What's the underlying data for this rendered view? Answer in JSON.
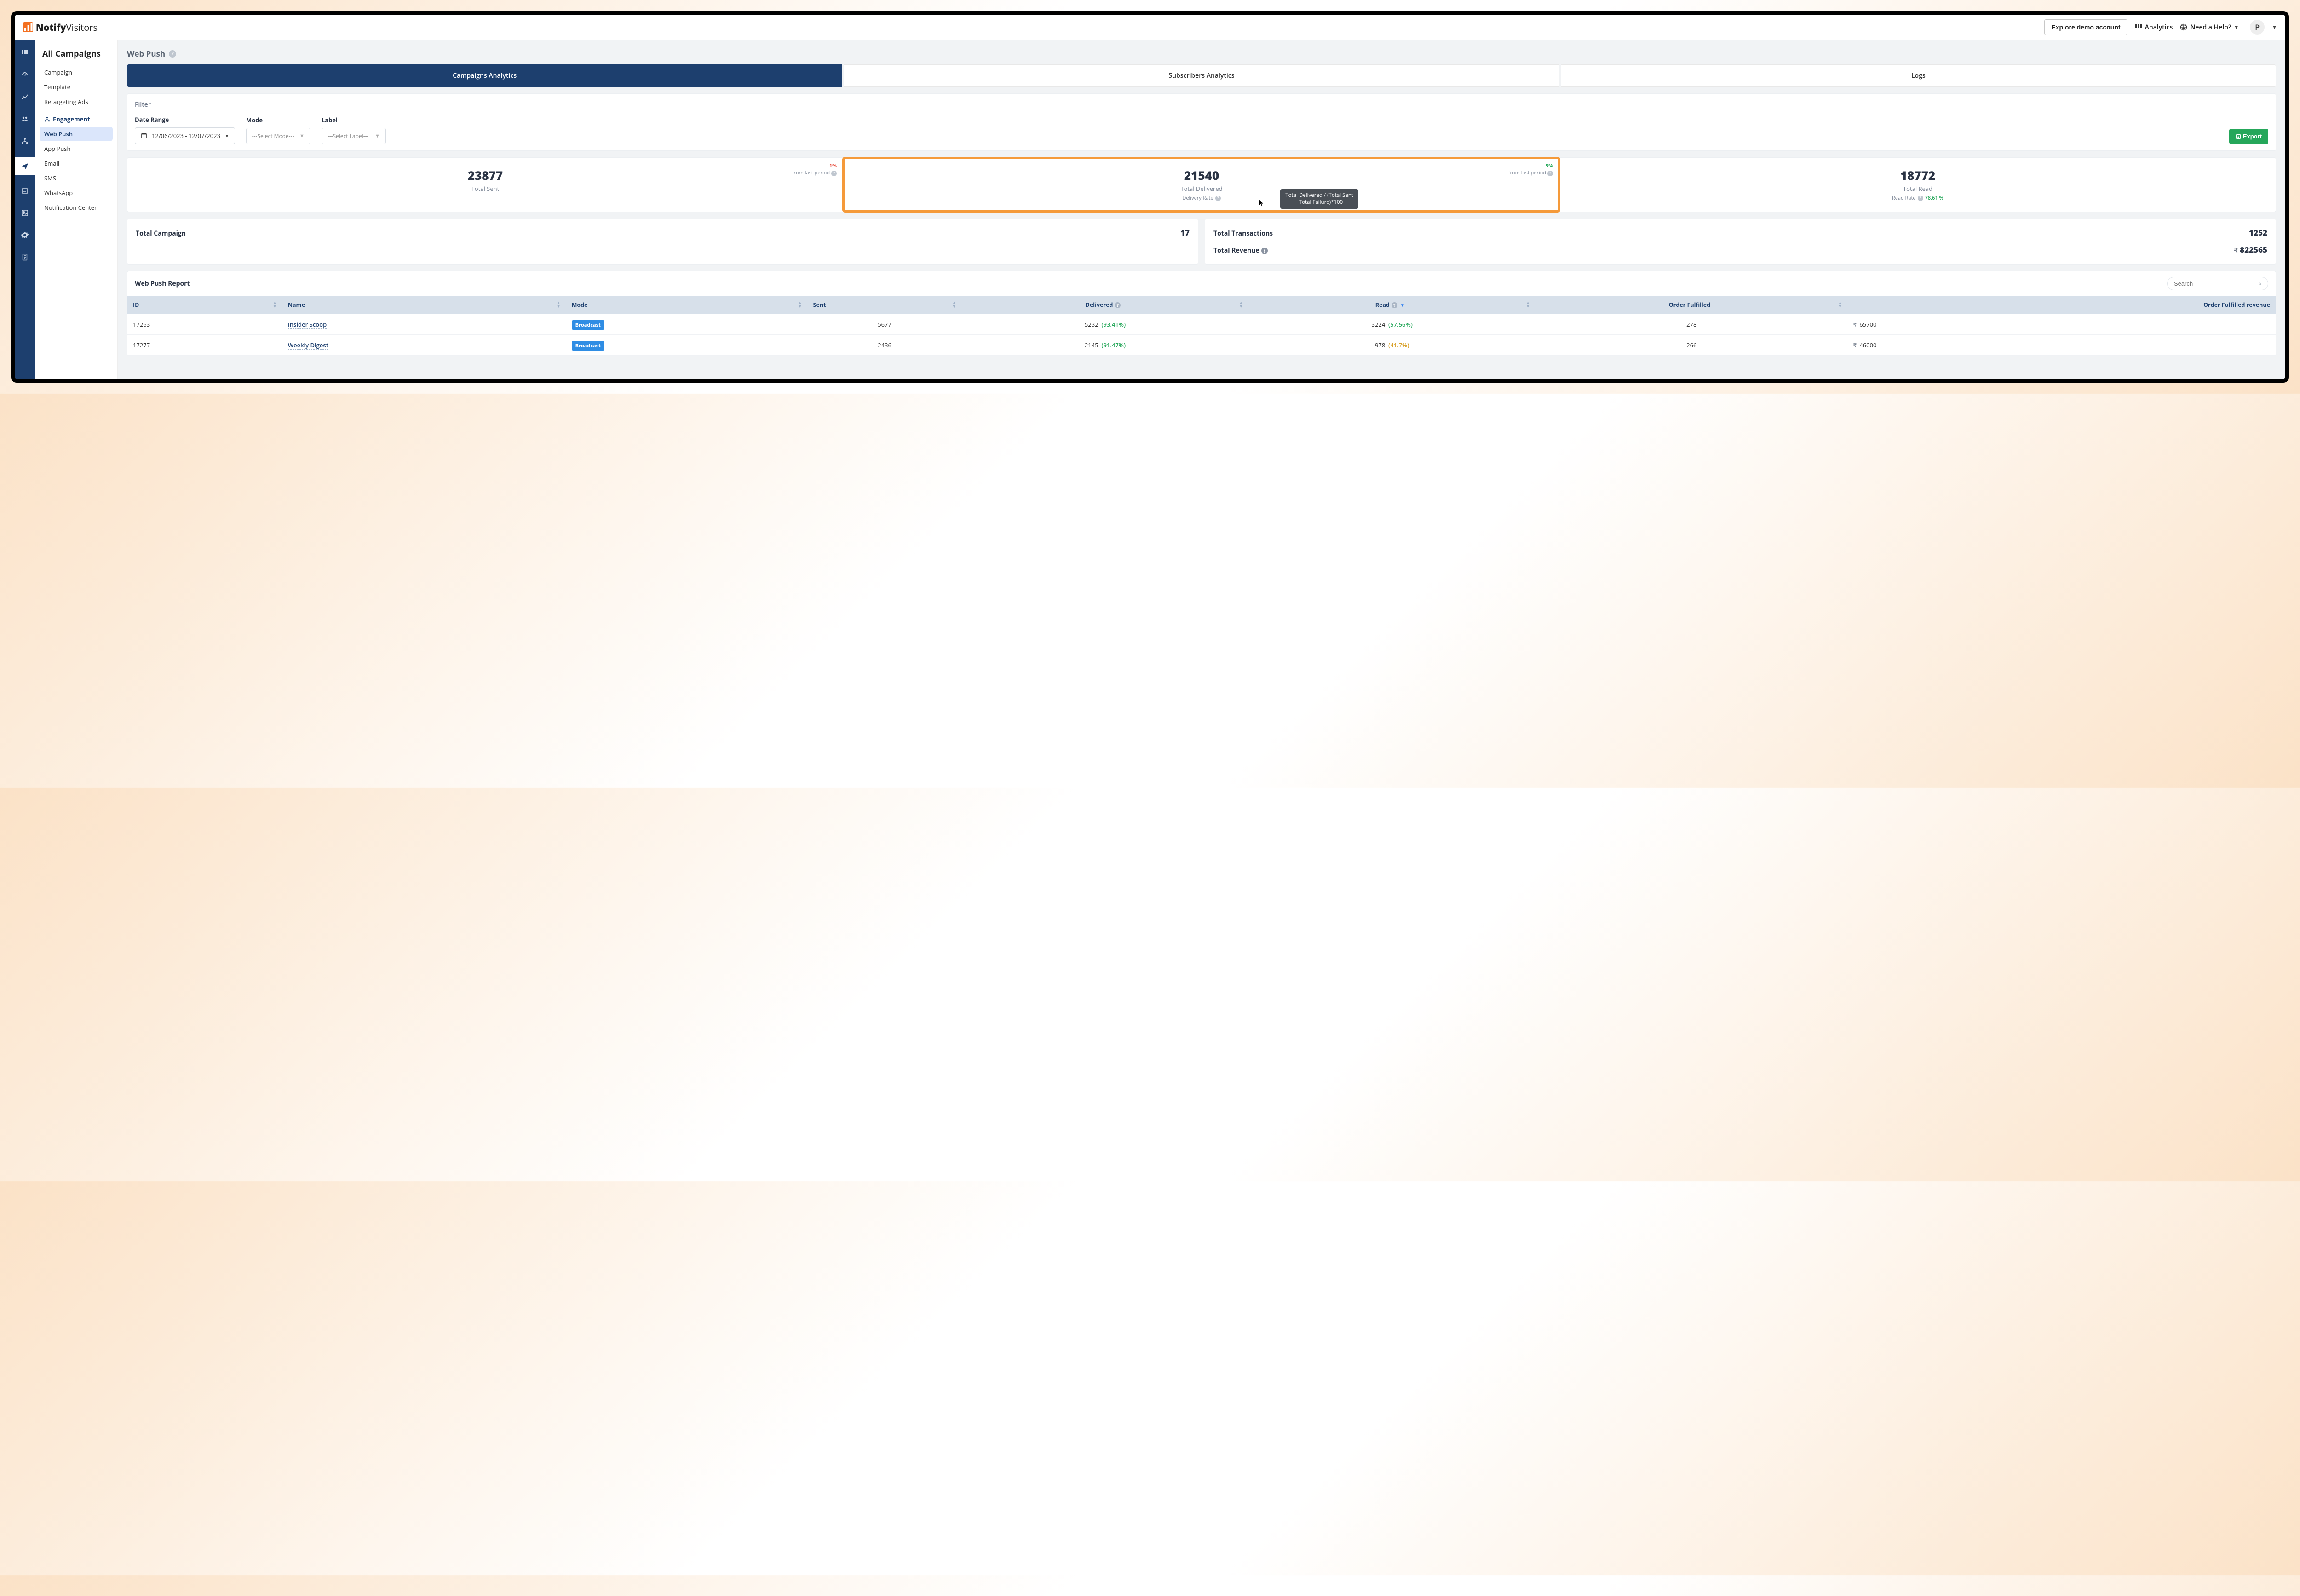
{
  "brand": {
    "prefix": "Notify",
    "suffix": "Visitors"
  },
  "topbar": {
    "demo": "Explore demo account",
    "analytics": "Analytics",
    "help": "Need a Help?",
    "avatar": "P"
  },
  "sidebar": {
    "title": "All Campaigns",
    "items": [
      {
        "label": "Campaign"
      },
      {
        "label": "Template"
      },
      {
        "label": "Retargeting Ads"
      }
    ],
    "group": "Engagement",
    "engagement_items": [
      {
        "label": "Web Push",
        "selected": true
      },
      {
        "label": "App Push"
      },
      {
        "label": "Email"
      },
      {
        "label": "SMS"
      },
      {
        "label": "WhatsApp"
      },
      {
        "label": "Notification Center"
      }
    ]
  },
  "page": {
    "title": "Web Push"
  },
  "tabs": [
    {
      "label": "Campaigns Analytics",
      "active": true
    },
    {
      "label": "Subscribers Analytics"
    },
    {
      "label": "Logs"
    }
  ],
  "filter": {
    "title": "Filter",
    "date_label": "Date Range",
    "date_value": "12/06/2023 - 12/07/2023",
    "mode_label": "Mode",
    "mode_placeholder": "---Select Mode---",
    "label_label": "Label",
    "label_placeholder": "---Select Label---",
    "export": "Export"
  },
  "stats": {
    "sent": {
      "value": "23877",
      "label": "Total Sent",
      "trend_pct": "1%",
      "trend_note": "from last period",
      "trend_color": "red"
    },
    "delivered": {
      "value": "21540",
      "label": "Total Delivered",
      "trend_pct": "5%",
      "trend_note": "from last period",
      "trend_color": "green",
      "sub_label": "Delivery Rate"
    },
    "read": {
      "value": "18772",
      "label": "Total Read",
      "sub_label": "Read Rate",
      "sub_value": "78.61 %"
    },
    "tooltip": "Total Delivered / (Total Sent - Total Failure)*100"
  },
  "summary": {
    "campaign_label": "Total Campaign",
    "campaign_value": "17",
    "transactions_label": "Total Transactions",
    "transactions_value": "1252",
    "revenue_label": "Total Revenue",
    "revenue_value": "822565"
  },
  "report": {
    "title": "Web Push Report",
    "search_placeholder": "Search",
    "columns": {
      "id": "ID",
      "name": "Name",
      "mode": "Mode",
      "sent": "Sent",
      "delivered": "Delivered",
      "read": "Read",
      "fulfilled": "Order Fulfilled",
      "revenue": "Order Fulfilled revenue"
    },
    "rows": [
      {
        "id": "17263",
        "name": "Insider Scoop",
        "mode": "Broadcast",
        "sent": "5677",
        "delivered": "5232",
        "delivered_pct": "(93.41%)",
        "read": "3224",
        "read_pct": "(57.56%)",
        "fulfilled": "278",
        "revenue": "65700"
      },
      {
        "id": "17277",
        "name": "Weekly Digest",
        "mode": "Broadcast",
        "sent": "2436",
        "delivered": "2145",
        "delivered_pct": "(91.47%)",
        "read": "978",
        "read_pct": "(41.7%)",
        "fulfilled": "266",
        "revenue": "46000"
      }
    ]
  }
}
